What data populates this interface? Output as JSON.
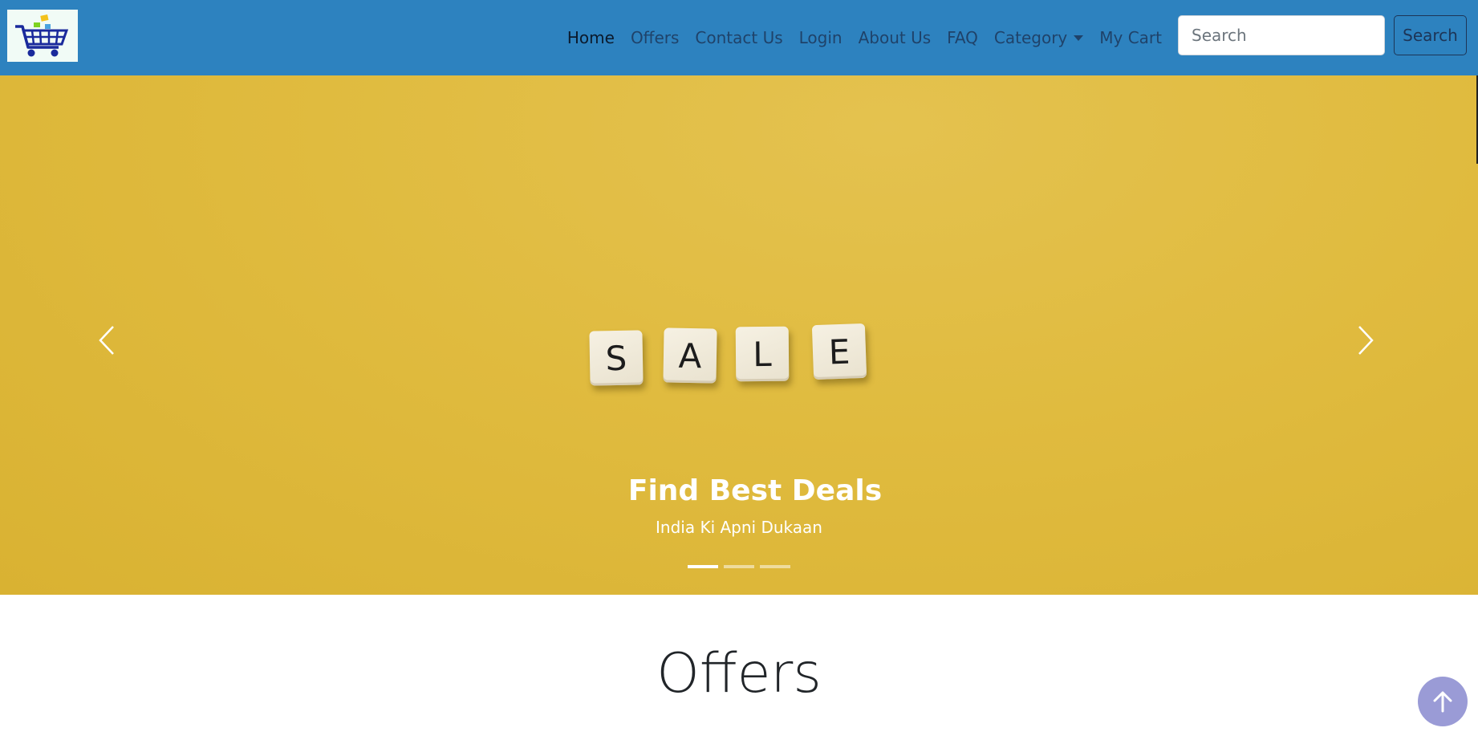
{
  "header": {
    "logo_icon": "shopping-cart-icon",
    "nav": [
      {
        "label": "Home",
        "active": true
      },
      {
        "label": "Offers"
      },
      {
        "label": "Contact Us"
      },
      {
        "label": "Login"
      },
      {
        "label": "About Us"
      },
      {
        "label": "FAQ"
      },
      {
        "label": "Category",
        "dropdown": true
      },
      {
        "label": "My Cart"
      }
    ],
    "search": {
      "placeholder": "Search",
      "value": "",
      "button_label": "Search"
    },
    "colors": {
      "navbar": "#2d82bf",
      "link": "#1d3557"
    }
  },
  "carousel": {
    "image_tiles": [
      "S",
      "A",
      "L",
      "E"
    ],
    "caption_title": "Find Best Deals",
    "caption_subtitle": "India Ki Apni Dukaan",
    "slide_count": 3,
    "active_slide": 1,
    "prev_icon": "chevron-left-icon",
    "next_icon": "chevron-right-icon",
    "background_color": "#e0bb3f"
  },
  "main": {
    "section_title": "Offers"
  },
  "back_to_top": {
    "icon": "arrow-up-icon",
    "color": "#9a9bd6"
  }
}
